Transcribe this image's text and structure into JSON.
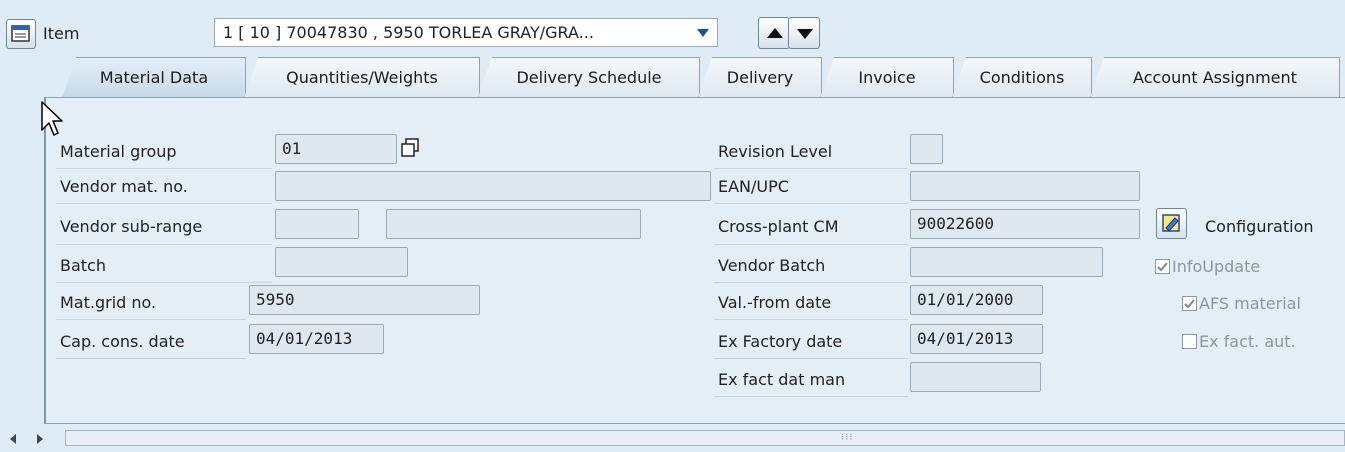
{
  "item_bar": {
    "label": "Item",
    "select_value": "1 [ 10 ] 70047830 , 5950 TORLEA GRAY/GRA..."
  },
  "tabs": [
    {
      "label": "Material Data",
      "active": true
    },
    {
      "label": "Quantities/Weights",
      "active": false
    },
    {
      "label": "Delivery Schedule",
      "active": false
    },
    {
      "label": "Delivery",
      "active": false
    },
    {
      "label": "Invoice",
      "active": false
    },
    {
      "label": "Conditions",
      "active": false
    },
    {
      "label": "Account Assignment",
      "active": false
    }
  ],
  "left": {
    "material_group": {
      "label": "Material group",
      "value": "01"
    },
    "vendor_mat_no": {
      "label": "Vendor mat. no.",
      "value": ""
    },
    "vendor_sub_range": {
      "label": "Vendor sub-range",
      "value": "",
      "value2": ""
    },
    "batch": {
      "label": "Batch",
      "value": ""
    },
    "mat_grid_no": {
      "label": "Mat.grid no.",
      "value": "5950"
    },
    "cap_cons_date": {
      "label": "Cap. cons. date",
      "value": "04/01/2013"
    }
  },
  "right": {
    "revision_level": {
      "label": "Revision Level",
      "value": ""
    },
    "ean_upc": {
      "label": "EAN/UPC",
      "value": ""
    },
    "cross_plant_cm": {
      "label": "Cross-plant CM",
      "value": "90022600"
    },
    "vendor_batch": {
      "label": "Vendor Batch",
      "value": ""
    },
    "val_from_date": {
      "label": "Val.-from date",
      "value": "01/01/2000"
    },
    "ex_factory_date": {
      "label": "Ex Factory date",
      "value": "04/01/2013"
    },
    "ex_fact_dat_man": {
      "label": "Ex fact dat man",
      "value": ""
    }
  },
  "side": {
    "configuration_label": "Configuration",
    "info_update": {
      "label": "InfoUpdate",
      "checked": true
    },
    "afs_material": {
      "label": "AFS material",
      "checked": true
    },
    "ex_fact_aut": {
      "label": "Ex fact. aut.",
      "checked": false
    }
  },
  "icons": {
    "item_overview": "item-overview-icon",
    "dropdown": "dropdown-arrow-icon",
    "prev": "arrow-up-icon",
    "next": "arrow-down-icon",
    "details": "details-copy-icon",
    "configuration": "configuration-edit-icon",
    "cursor": "mouse-pointer-icon",
    "scroll_left": "scroll-left-icon",
    "scroll_right": "scroll-right-icon"
  },
  "colors": {
    "background": "#dfebf5",
    "panel": "#e3eef7",
    "field": "#dfe8f0",
    "field_border": "#9cabb8",
    "accent_dark": "#1a1a1a"
  }
}
